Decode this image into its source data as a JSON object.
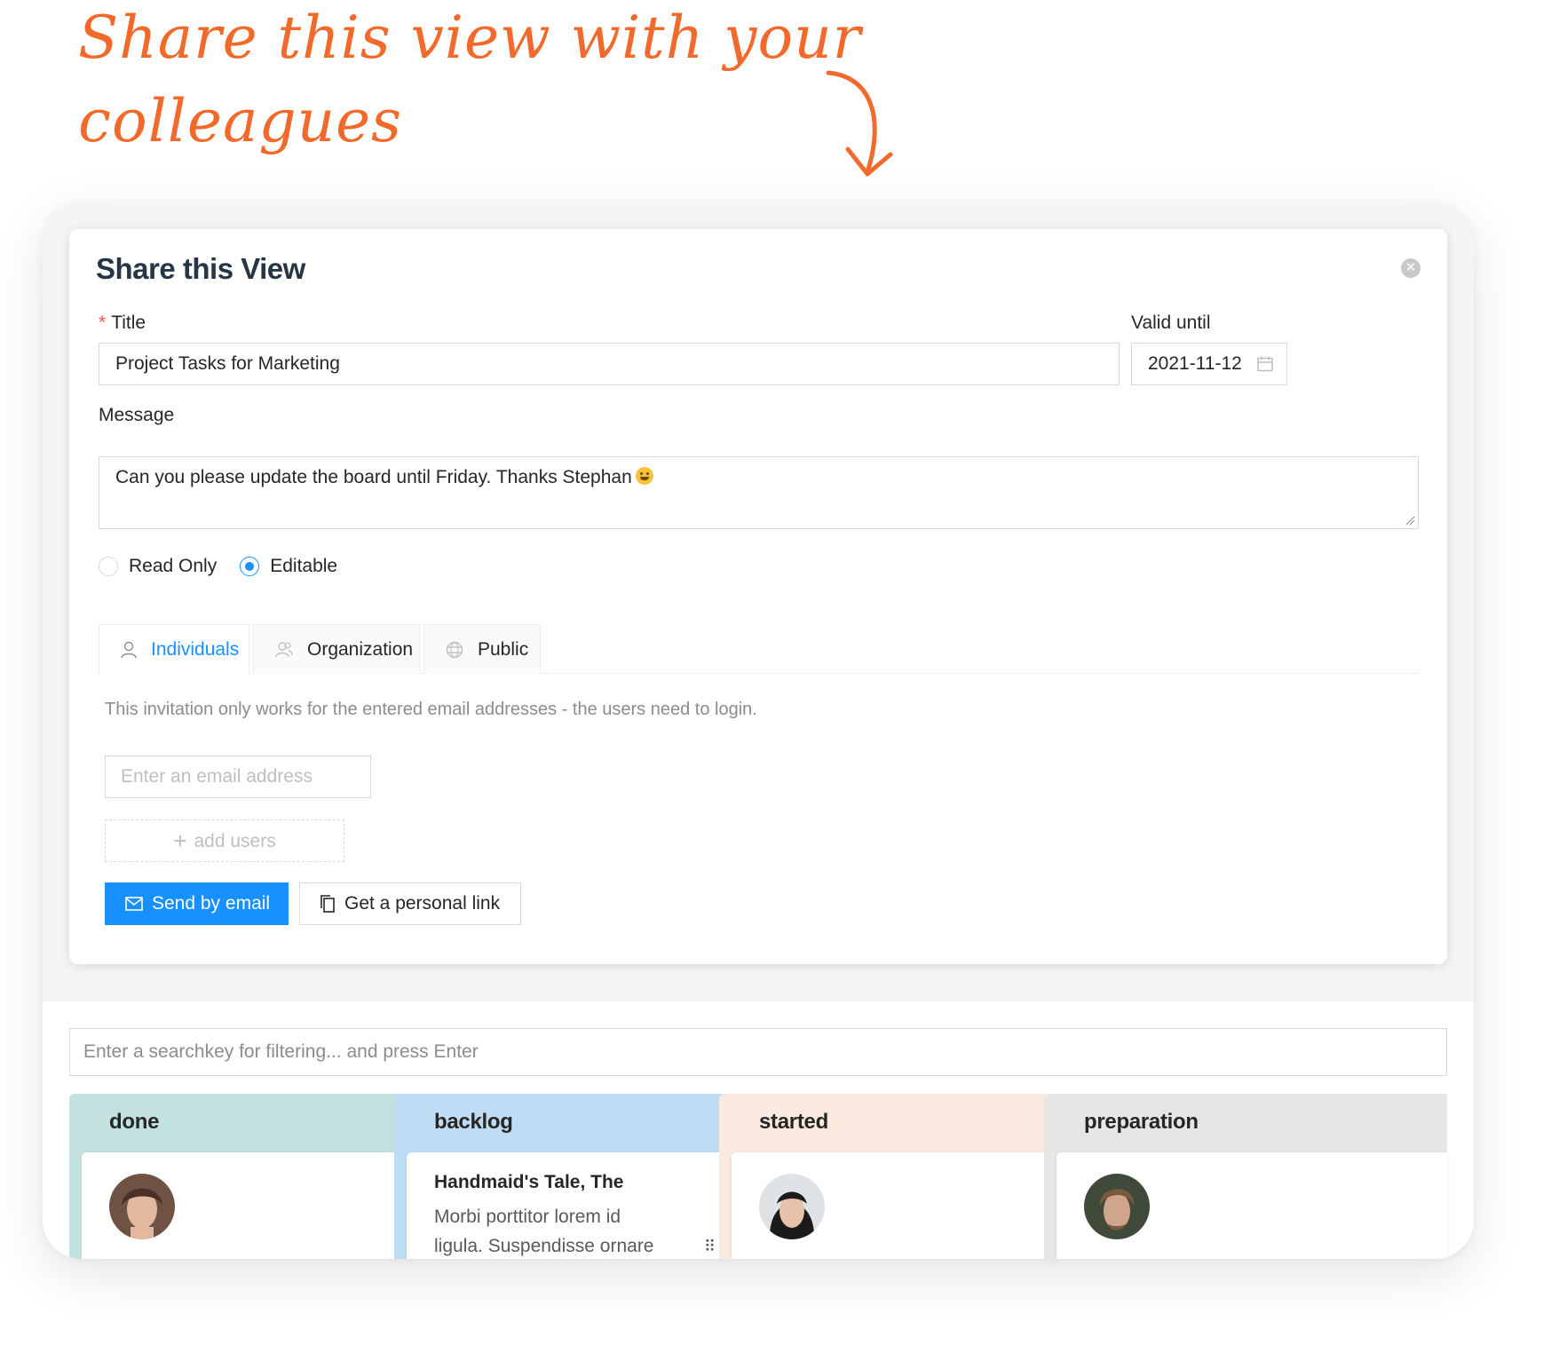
{
  "annotation": {
    "line1": "Share this view with your",
    "line2": "colleagues",
    "color": "#f26a2b"
  },
  "modal": {
    "title": "Share this View",
    "title_label": "Title",
    "title_value": "Project Tasks for Marketing",
    "valid_until_label": "Valid until",
    "valid_until_value": "2021-11-12",
    "message_label": "Message",
    "message_value": "Can you please update the board until Friday. Thanks Stephan",
    "access": {
      "options": [
        "Read Only",
        "Editable"
      ],
      "selected": "Editable"
    },
    "tabs": {
      "individuals": "Individuals",
      "organization": "Organization",
      "public": "Public",
      "active": "Individuals"
    },
    "hint": "This invitation only works for the entered email addresses - the users need to login.",
    "email_placeholder": "Enter an email address",
    "add_users_label": "add users",
    "send_email_label": "Send by email",
    "personal_link_label": "Get a personal link",
    "accent_color": "#1890ff"
  },
  "board": {
    "search_placeholder": "Enter a searchkey for filtering... and press Enter",
    "columns": [
      {
        "title": "done",
        "color": "#c2e1df"
      },
      {
        "title": "backlog",
        "color": "#bfdcf5",
        "card_title": "Handmaid's Tale, The",
        "card_text": "Morbi porttitor lorem id ligula. Suspendisse ornare"
      },
      {
        "title": "started",
        "color": "#faeadf"
      },
      {
        "title": "preparation",
        "color": "#e6e7e5"
      }
    ]
  }
}
